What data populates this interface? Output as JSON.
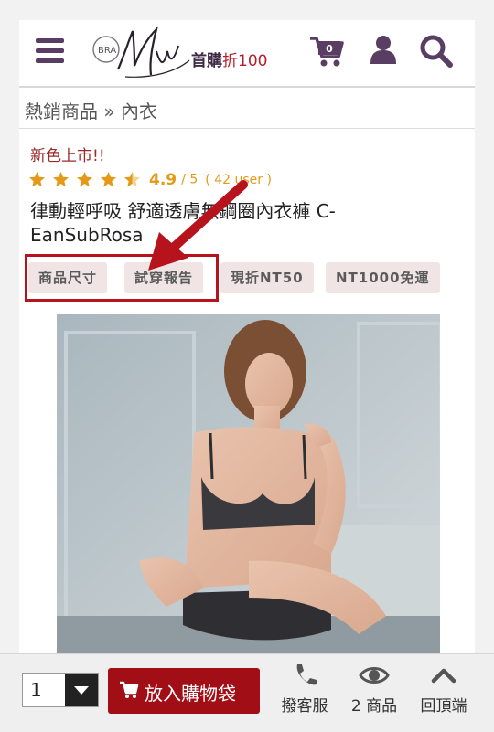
{
  "header": {
    "logo_small": "BRA",
    "promo_prefix": "首購",
    "promo_accent": "折100",
    "cart_count": "0",
    "colors": {
      "brand_purple": "#5a3d63",
      "accent_red": "#b3202a"
    }
  },
  "breadcrumb": {
    "text": "熱銷商品 » 內衣"
  },
  "product": {
    "badge": "新色上市!!",
    "rating": {
      "score": "4.9",
      "max": "/ 5",
      "count": "( 42 user )",
      "stars": 4.5
    },
    "title": "律動輕呼吸 舒適透膚無鋼圈內衣褲 C-EanSubRosa",
    "tags": [
      "商品尺寸",
      "試穿報告",
      "現折NT50",
      "NT1000免運"
    ]
  },
  "bottom_bar": {
    "quantity": "1",
    "add_to_cart": "放入購物袋",
    "service": "撥客服",
    "viewed": "2 商品",
    "top": "回頂端"
  },
  "icons": [
    "menu-icon",
    "cart-icon",
    "user-icon",
    "search-icon",
    "star-icon",
    "phone-icon",
    "eye-icon",
    "chevron-up-icon",
    "cart-icon"
  ]
}
